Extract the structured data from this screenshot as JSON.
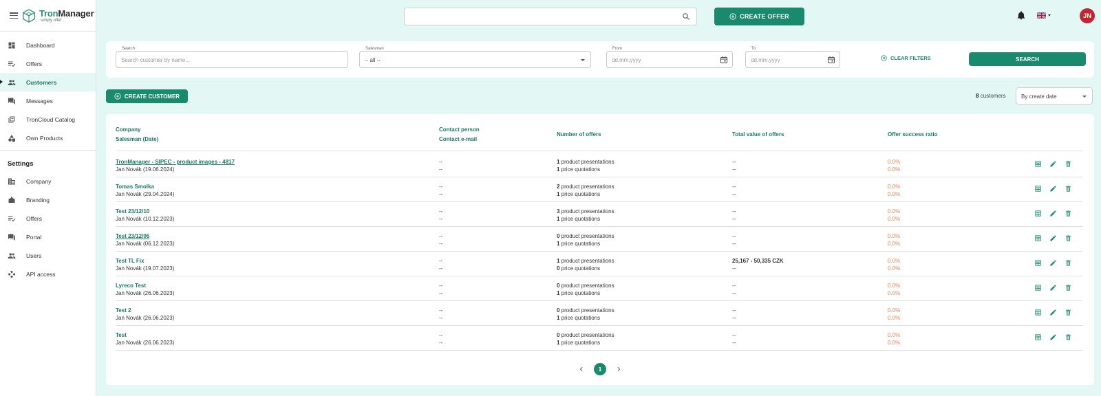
{
  "app": {
    "name_part1": "Tron",
    "name_part2": "Manager",
    "tagline": "simply offer"
  },
  "sidebar": {
    "main": [
      {
        "label": "Dashboard",
        "icon": "dashboard-icon"
      },
      {
        "label": "Offers",
        "icon": "checklist-icon"
      },
      {
        "label": "Customers",
        "icon": "people-icon",
        "active": true
      },
      {
        "label": "Messages",
        "icon": "chat-icon"
      },
      {
        "label": "TronCloud Catalog",
        "icon": "catalog-icon"
      },
      {
        "label": "Own Products",
        "icon": "shapes-icon"
      }
    ],
    "settings_title": "Settings",
    "settings": [
      {
        "label": "Company",
        "icon": "building-icon"
      },
      {
        "label": "Branding",
        "icon": "branding-icon"
      },
      {
        "label": "Offers",
        "icon": "checklist-icon"
      },
      {
        "label": "Portal",
        "icon": "chat-icon"
      },
      {
        "label": "Users",
        "icon": "people-icon"
      },
      {
        "label": "API access",
        "icon": "api-icon"
      }
    ]
  },
  "topbar": {
    "search_value": "",
    "create_offer_label": "CREATE OFFER",
    "avatar_initials": "JN"
  },
  "filters": {
    "search_label": "Search",
    "search_placeholder": "Search customer by name...",
    "salesman_label": "Salesman",
    "salesman_value": "-- all --",
    "from_label": "From",
    "from_placeholder": "dd.mm.yyyy",
    "to_label": "To",
    "to_placeholder": "dd.mm.yyyy",
    "clear_label": "CLEAR FILTERS",
    "search_button": "SEARCH"
  },
  "actions": {
    "create_customer_label": "CREATE CUSTOMER",
    "count_number": "8",
    "count_suffix": " customers",
    "sort_value": "By create date"
  },
  "table": {
    "headers": {
      "company": "Company",
      "salesman": "Salesman (Date)",
      "contact_person": "Contact person",
      "contact_email": "Contact e-mail",
      "offers": "Number of offers",
      "value": "Total value of offers",
      "ratio": "Offer success ratio"
    },
    "rows": [
      {
        "company": "TronManager - SIPEC - product images - 4817",
        "underline": true,
        "salesman": "Jan Novák (19.06.2024)",
        "contact_person": "--",
        "contact_email": "--",
        "pres_count": "1",
        "pres_label": " product presentations",
        "quot_count": "1",
        "quot_label": " price quotations",
        "value1": "--",
        "value2": "--",
        "ratio1": "0.0%",
        "ratio2": "0.0%"
      },
      {
        "company": "Tomas Smolka",
        "underline": false,
        "salesman": "Jan Novák (29.04.2024)",
        "contact_person": "--",
        "contact_email": "--",
        "pres_count": "2",
        "pres_label": " product presentations",
        "quot_count": "1",
        "quot_label": " price quotations",
        "value1": "--",
        "value2": "--",
        "ratio1": "0.0%",
        "ratio2": "0.0%"
      },
      {
        "company": "Test 23/12/10",
        "underline": false,
        "salesman": "Jan Novák (10.12.2023)",
        "contact_person": "--",
        "contact_email": "--",
        "pres_count": "3",
        "pres_label": " product presentations",
        "quot_count": "1",
        "quot_label": " price quotations",
        "value1": "--",
        "value2": "--",
        "ratio1": "0.0%",
        "ratio2": "0.0%"
      },
      {
        "company": "Test 23/12/06",
        "underline": true,
        "salesman": "Jan Novák (06.12.2023)",
        "contact_person": "--",
        "contact_email": "--",
        "pres_count": "0",
        "pres_label": " product presentations",
        "quot_count": "1",
        "quot_label": " price quotations",
        "value1": "--",
        "value2": "--",
        "ratio1": "0.0%",
        "ratio2": "0.0%"
      },
      {
        "company": "Test TL Fix",
        "underline": false,
        "salesman": "Jan Novák (19.07.2023)",
        "contact_person": "--",
        "contact_email": "--",
        "pres_count": "1",
        "pres_label": " product presentations",
        "quot_count": "0",
        "quot_label": " price quotations",
        "value1": "25,167 - 50,335 CZK",
        "value1_bold": true,
        "value2": "--",
        "ratio1": "0.0%",
        "ratio2": "0.0%"
      },
      {
        "company": "Lyreco Test",
        "underline": false,
        "salesman": "Jan Novák (26.06.2023)",
        "contact_person": "--",
        "contact_email": "--",
        "pres_count": "0",
        "pres_label": " product presentations",
        "quot_count": "1",
        "quot_label": " price quotations",
        "value1": "--",
        "value2": "--",
        "ratio1": "0.0%",
        "ratio2": "0.0%"
      },
      {
        "company": "Test 2",
        "underline": false,
        "salesman": "Jan Novák (26.06.2023)",
        "contact_person": "--",
        "contact_email": "--",
        "pres_count": "0",
        "pres_label": " product presentations",
        "quot_count": "1",
        "quot_label": " price quotations",
        "value1": "--",
        "value2": "--",
        "ratio1": "0.0%",
        "ratio2": "0.0%"
      },
      {
        "company": "Test",
        "underline": false,
        "salesman": "Jan Novák (26.06.2023)",
        "contact_person": "--",
        "contact_email": "--",
        "pres_count": "0",
        "pres_label": " product presentations",
        "quot_count": "1",
        "quot_label": " price quotations",
        "value1": "--",
        "value2": "--",
        "ratio1": "0.0%",
        "ratio2": "0.0%"
      }
    ]
  },
  "pagination": {
    "current": "1"
  },
  "colors": {
    "accent": "#1a8a6e",
    "background": "#e3f7f4",
    "ratio": "#e8845a",
    "avatar": "#c0262d"
  }
}
